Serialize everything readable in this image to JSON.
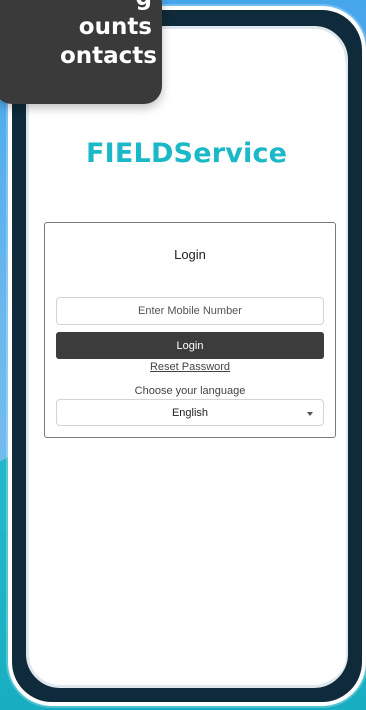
{
  "overlay": {
    "lines": [
      "g",
      "ounts",
      "ontacts"
    ]
  },
  "app": {
    "logo_text": "FIELDService"
  },
  "login": {
    "title": "Login",
    "mobile_placeholder": "Enter Mobile Number",
    "login_button": "Login",
    "reset_link": "Reset Password",
    "language_label": "Choose your language",
    "language_value": "English"
  },
  "colors": {
    "brand": "#1bb8c7",
    "button": "#3c3c3c",
    "background_blue": "#46a6ec",
    "background_teal": "#23b7c9"
  }
}
